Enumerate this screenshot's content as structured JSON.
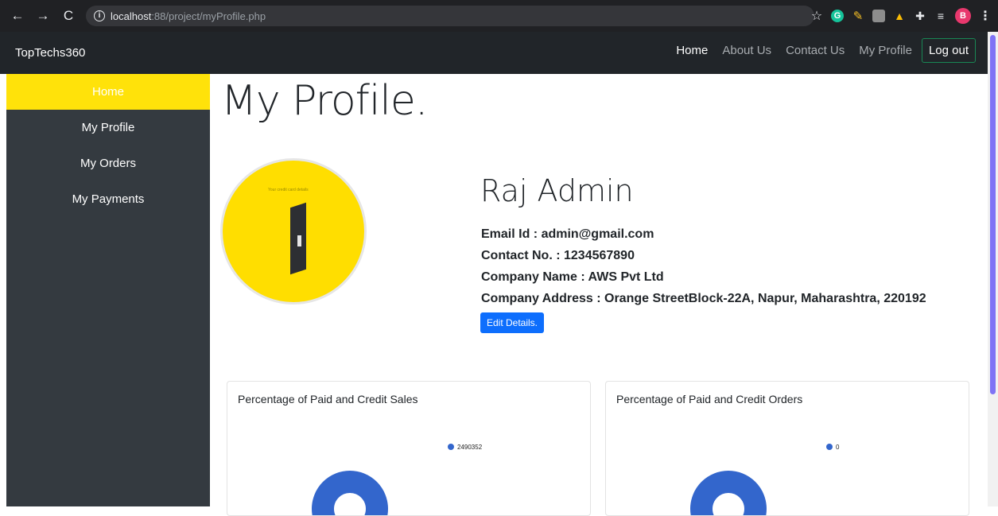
{
  "browser": {
    "url_host": "localhost",
    "url_path": ":88/project/myProfile.php",
    "profile_initial": "B"
  },
  "navbar": {
    "brand": "TopTechs360",
    "links": [
      "Home",
      "About Us",
      "Contact Us",
      "My Profile"
    ],
    "logout_label": "Log out"
  },
  "sidebar": {
    "items": [
      {
        "label": "Home",
        "active": true
      },
      {
        "label": "My Profile",
        "active": false
      },
      {
        "label": "My Orders",
        "active": false
      },
      {
        "label": "My Payments",
        "active": false
      }
    ]
  },
  "main": {
    "page_title": "My Profile.",
    "avatar_caption": "Your credit card details",
    "profile": {
      "name": "Raj Admin",
      "email": "Email Id : admin@gmail.com",
      "contact": "Contact No. : 1234567890",
      "company": "Company Name : AWS Pvt Ltd",
      "address": "Company Address : Orange StreetBlock-22A, Napur, Maharashtra, 220192"
    },
    "edit_label": "Edit Details."
  },
  "colors": {
    "accent": "#ffe20a",
    "primary": "#0d6efd",
    "chart_series": "#3366cc",
    "navbar": "#212529",
    "sidebar": "#343a40"
  },
  "chart_data": [
    {
      "type": "pie",
      "title": "Percentage of Paid and Credit Sales",
      "series": [
        {
          "values": [
            2490352
          ]
        }
      ],
      "legend": [
        "2490352"
      ],
      "legend_position": "right"
    },
    {
      "type": "pie",
      "title": "Percentage of Paid and Credit Orders",
      "series": [
        {
          "values": [
            0
          ]
        }
      ],
      "legend": [
        "0"
      ],
      "legend_position": "right"
    }
  ]
}
